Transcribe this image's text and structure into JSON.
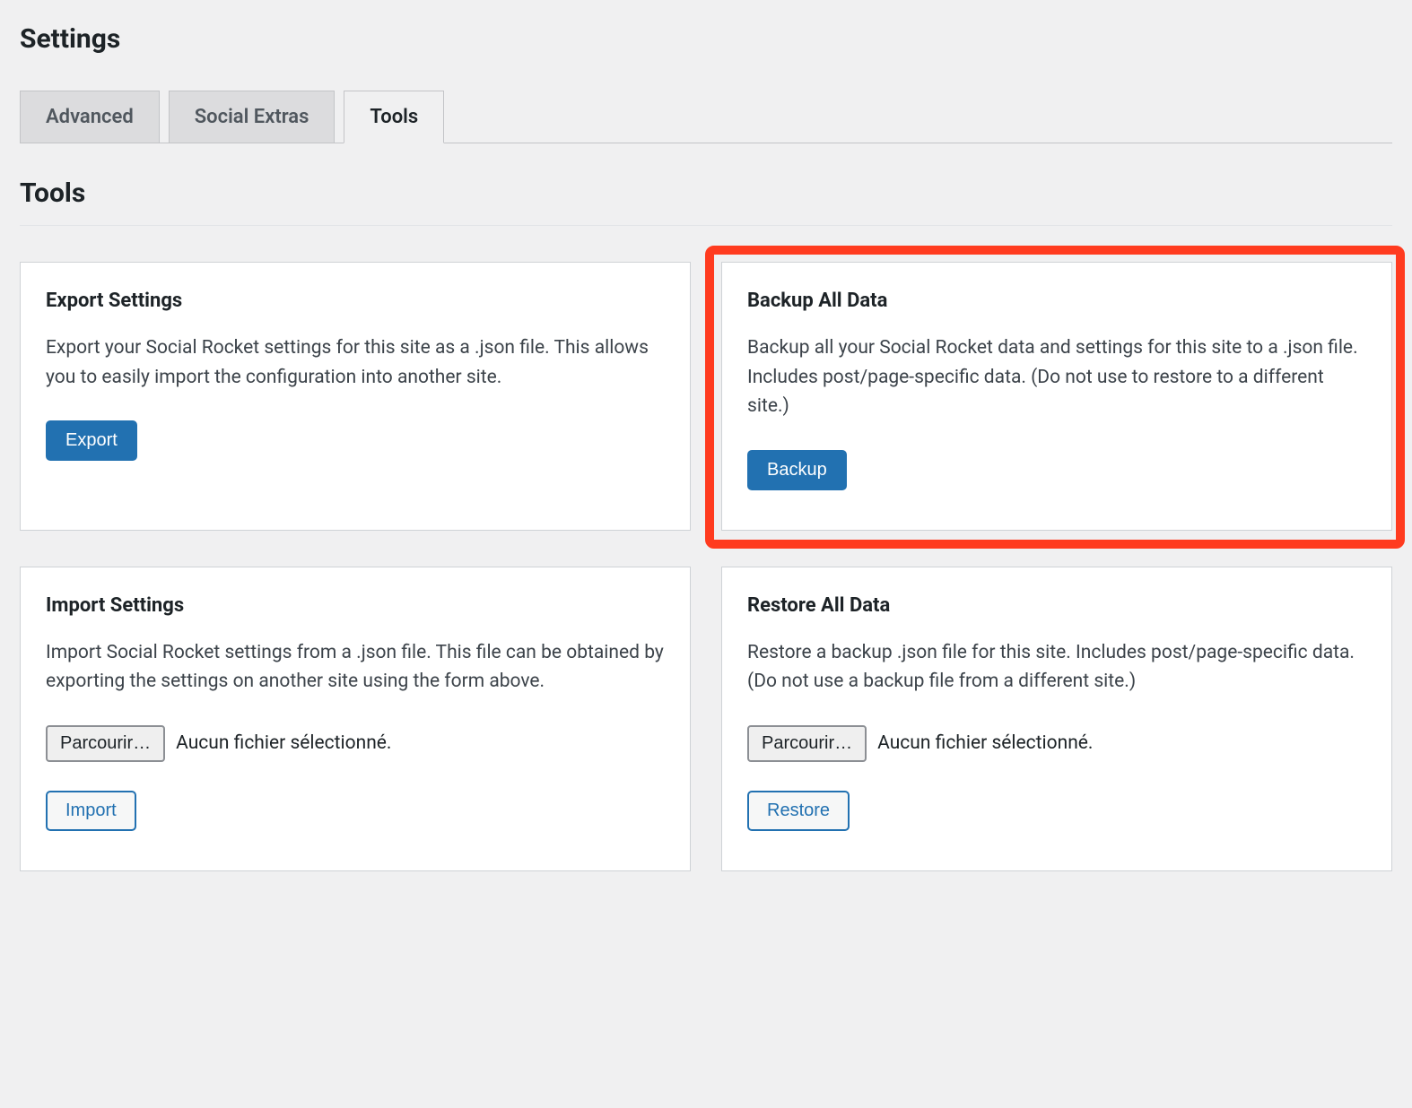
{
  "page": {
    "title": "Settings"
  },
  "tabs": {
    "advanced": "Advanced",
    "social_extras": "Social Extras",
    "tools": "Tools"
  },
  "section": {
    "title": "Tools"
  },
  "cards": {
    "export": {
      "title": "Export Settings",
      "desc": "Export your Social Rocket settings for this site as a .json file. This allows you to easily import the configuration into another site.",
      "button": "Export"
    },
    "backup": {
      "title": "Backup All Data",
      "desc": "Backup all your Social Rocket data and settings for this site to a .json file. Includes post/page-specific data. (Do not use to restore to a different site.)",
      "button": "Backup"
    },
    "import": {
      "title": "Import Settings",
      "desc": "Import Social Rocket settings from a .json file. This file can be obtained by exporting the settings on another site using the form above.",
      "browse": "Parcourir…",
      "status": "Aucun fichier sélectionné.",
      "button": "Import"
    },
    "restore": {
      "title": "Restore All Data",
      "desc": "Restore a backup .json file for this site. Includes post/page-specific data. (Do not use a backup file from a different site.)",
      "browse": "Parcourir…",
      "status": "Aucun fichier sélectionné.",
      "button": "Restore"
    }
  }
}
